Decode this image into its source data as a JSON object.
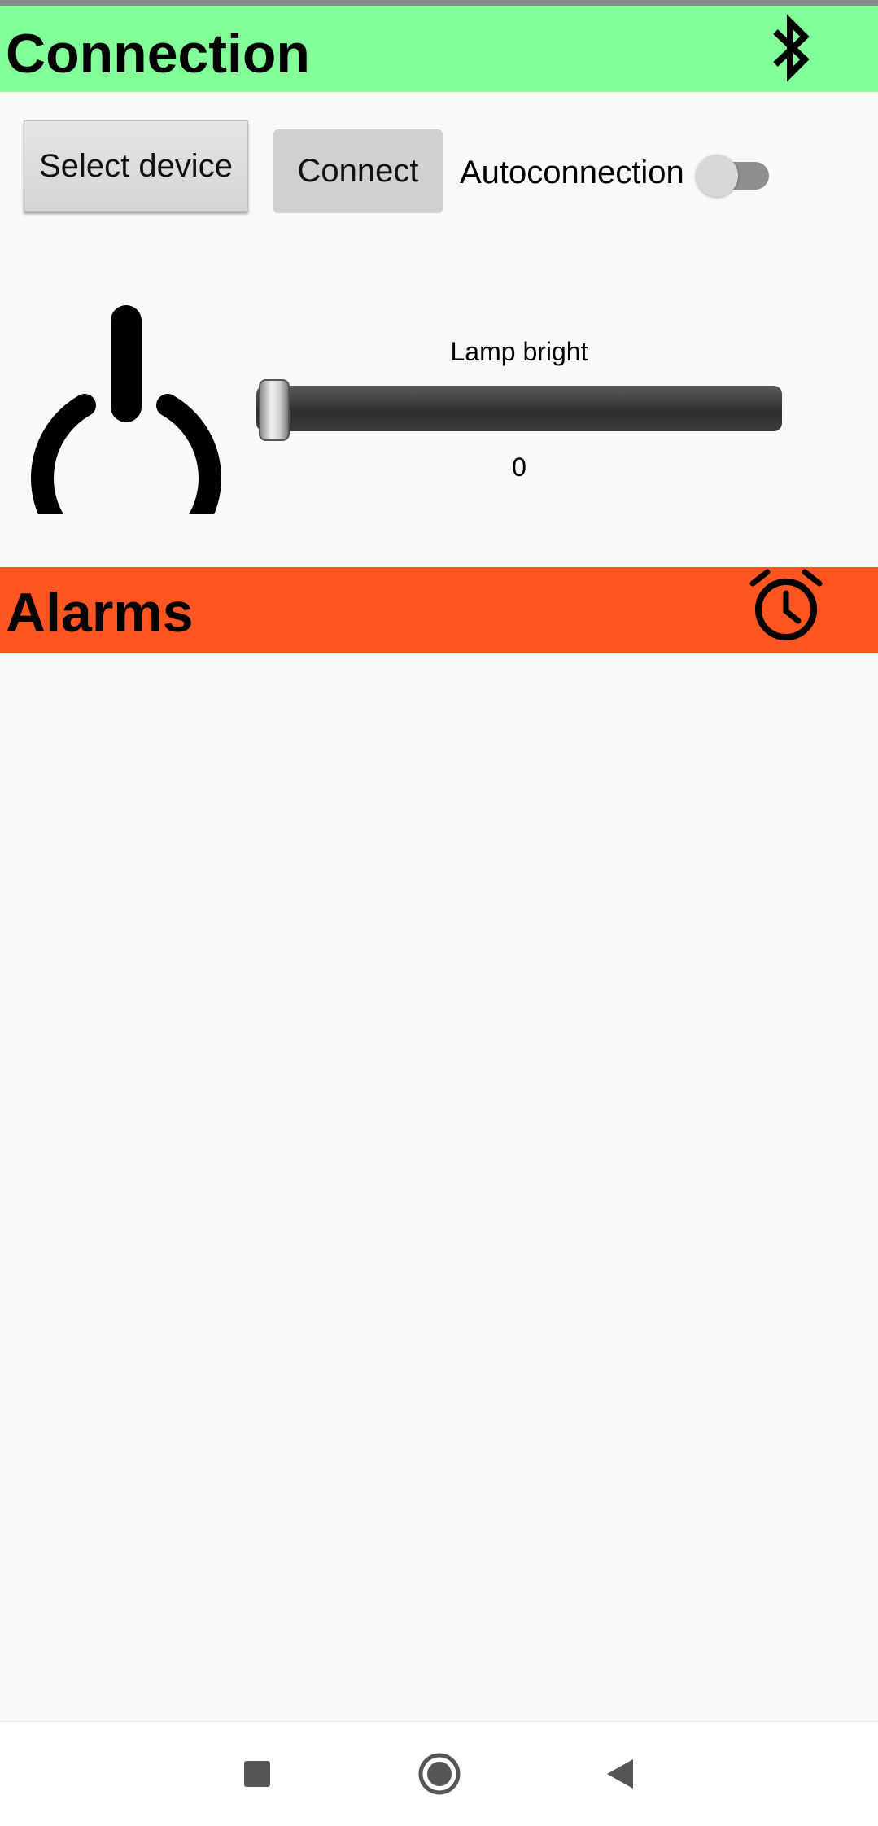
{
  "connection": {
    "title": "Connection",
    "icon": "bluetooth-icon",
    "bar_color": "#82ff99",
    "select_device_label": "Select device",
    "connect_label": "Connect",
    "autoconnection_label": "Autoconnection",
    "autoconnection_enabled": false
  },
  "lamp": {
    "power_icon": "power-icon",
    "slider_label": "Lamp bright",
    "value": "0",
    "value_fraction": 0
  },
  "alarms": {
    "title": "Alarms",
    "icon": "alarm-clock-icon",
    "bar_color": "#ff5521"
  },
  "navbar": {
    "recents_icon": "square-icon",
    "home_icon": "circle-icon",
    "back_icon": "triangle-back-icon"
  }
}
